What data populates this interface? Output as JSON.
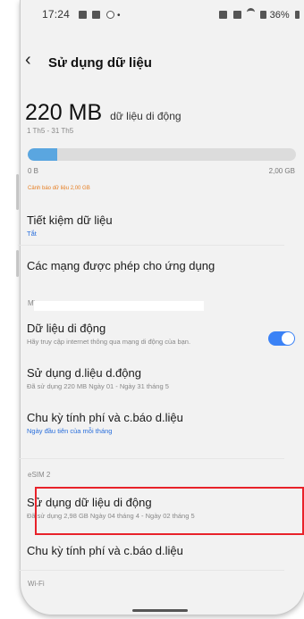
{
  "status_bar": {
    "time": "17:24",
    "battery": "36%"
  },
  "header": {
    "back_icon": "chevron-left",
    "title": "Sử dụng dữ liệu"
  },
  "usage": {
    "amount": "220 MB",
    "unit_label": "dữ liệu di động",
    "period": "1 Th5 - 31 Th5",
    "bar_min": "0 B",
    "bar_max": "2,00 GB",
    "fill_fraction": 0.11,
    "warning": "Cảnh báo dữ liệu 2,00 GB"
  },
  "saver": {
    "title": "Tiết kiệm dữ liệu",
    "value": "Tắt"
  },
  "allowed_networks": {
    "title": "Các mạng được phép cho ứng dụng"
  },
  "sim1": {
    "section_label": "M\\",
    "mobile_data": {
      "title": "Dữ liệu di động",
      "subtitle": "Hãy truy cập internet thông qua mạng di động của bạn.",
      "enabled": true
    },
    "usage": {
      "title": "Sử dụng d.liệu d.động",
      "subtitle": "Đã sử dụng 220 MB Ngày 01 - Ngày 31 tháng 5"
    },
    "billing": {
      "title": "Chu kỳ tính phí và c.báo d.liệu",
      "subtitle": "Ngày đầu tiên của mỗi tháng"
    }
  },
  "sim2": {
    "section_label": "eSIM 2",
    "usage": {
      "title": "Sử dụng dữ liệu di động",
      "subtitle": "Đã sử dụng 2,98 GB Ngày 04 tháng 4 - Ngày 02 tháng 5"
    },
    "billing": {
      "title": "Chu kỳ tính phí và c.báo d.liệu"
    }
  },
  "wifi": {
    "section_label": "Wi-Fi"
  },
  "colors": {
    "accent": "#3b82f6",
    "link": "#2a6fdc",
    "warning": "#e67e22",
    "highlight": "#e8222a"
  }
}
